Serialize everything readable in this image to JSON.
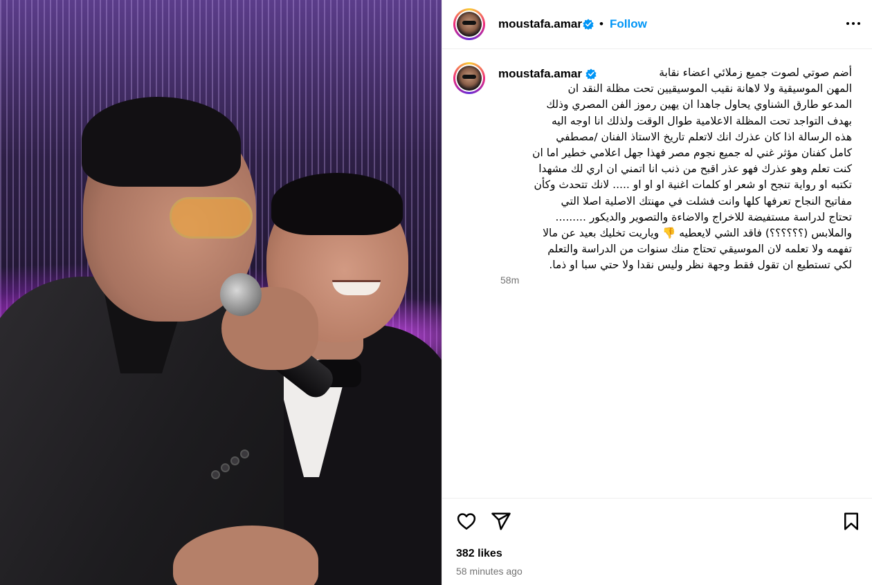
{
  "post": {
    "username": "moustafa.amar",
    "follow_label": "Follow",
    "separator": "•",
    "caption": "أضم صوتي لصوت جميع زملائي اعضاء نقابة\nالمهن الموسيقية ولا لاهانة نقيب الموسيقيين تحت مظلة النقد ان\nالمدعو طارق الشناوي يحاول جاهدا ان يهين رموز الفن المصري وذلك\nبهدف التواجد تحت المظلة الاعلامية طوال الوقت ولذلك انا اوجه اليه\nهذه الرسالة اذا كان عذرك انك لاتعلم تاريخ الاستاذ الفنان /مصطفي\nكامل كفنان مؤثر غني له جميع نجوم مصر فهذا جهل اعلامي خطير اما ان\nكنت تعلم وهو عذرك فهو عذر اقبح من ذنب انا اتمني ان اري لك مشهدا\nتكتبه او رواية تنجح او شعر او كلمات اغنية او او او ..... لانك تتحدث وكأن\nمفاتيح النجاح تعرفها كلها وانت فشلت في مهنتك الاصلية اصلا التي\nتحتاج لدراسة مستفيضة للاخراج والاضاءة والتصوير والديكور .........\nوالملابس (؟؟؟؟؟؟) فاقد الشي لايعطيه 👎 وياريت تخليك بعيد عن مالا\nتفهمه ولا تعلمه لان الموسيقي تحتاج منك سنوات من الدراسة والتعلم\nلكي تستطيع ان تقول فقط وجهة نظر وليس نقدا ولا حتي سبا او ذما.",
    "caption_time": "58m",
    "likes": "382 likes",
    "posted_ago": "58 minutes ago"
  },
  "icons": {
    "verified": "verified-badge-icon",
    "more": "more-options-icon",
    "like": "heart-icon",
    "share": "share-icon",
    "save": "bookmark-icon"
  },
  "colors": {
    "link_blue": "#0095f6",
    "verified_blue": "#0095f6",
    "muted": "#737373"
  }
}
